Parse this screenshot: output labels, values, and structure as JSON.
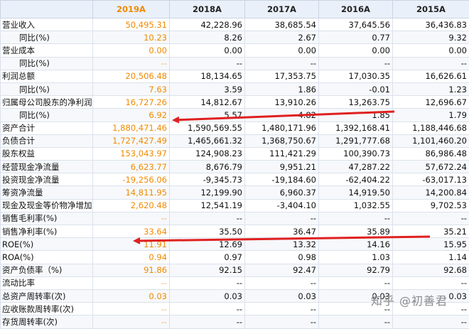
{
  "columns": [
    "",
    "2019A",
    "2018A",
    "2017A",
    "2016A",
    "2015A"
  ],
  "highlight_color": "#f08a00",
  "arrow_color": "#e02020",
  "rows": [
    {
      "label": "营业收入",
      "sub": false,
      "values": [
        "50,495.31",
        "42,228.96",
        "38,685.54",
        "37,645.56",
        "36,436.83"
      ]
    },
    {
      "label": "同比(%)",
      "sub": true,
      "values": [
        "10.23",
        "8.26",
        "2.67",
        "0.77",
        "9.32"
      ]
    },
    {
      "label": "营业成本",
      "sub": false,
      "values": [
        "0.00",
        "0.00",
        "0.00",
        "0.00",
        "0.00"
      ]
    },
    {
      "label": "同比(%)",
      "sub": true,
      "values": [
        "--",
        "--",
        "--",
        "--",
        "--"
      ]
    },
    {
      "label": "利润总额",
      "sub": false,
      "values": [
        "20,506.48",
        "18,134.65",
        "17,353.75",
        "17,030.35",
        "16,626.61"
      ]
    },
    {
      "label": "同比(%)",
      "sub": true,
      "values": [
        "7.63",
        "3.59",
        "1.86",
        "-0.01",
        "1.23"
      ]
    },
    {
      "label": "归属母公司股东的净利润",
      "sub": false,
      "values": [
        "16,727.26",
        "14,812.67",
        "13,910.26",
        "13,263.75",
        "12,696.67"
      ]
    },
    {
      "label": "同比(%)",
      "sub": true,
      "values": [
        "6.92",
        "5.57",
        "4.82",
        "1.85",
        "1.79"
      ]
    },
    {
      "label": "资产合计",
      "sub": false,
      "section": true,
      "values": [
        "1,880,471.46",
        "1,590,569.55",
        "1,480,171.96",
        "1,392,168.41",
        "1,188,446.68"
      ]
    },
    {
      "label": "负债合计",
      "sub": false,
      "values": [
        "1,727,427.49",
        "1,465,661.32",
        "1,368,750.67",
        "1,291,777.68",
        "1,101,460.20"
      ]
    },
    {
      "label": "股东权益",
      "sub": false,
      "values": [
        "153,043.97",
        "124,908.23",
        "111,421.29",
        "100,390.73",
        "86,986.48"
      ]
    },
    {
      "label": "经营现金净流量",
      "sub": false,
      "section": true,
      "values": [
        "6,623.77",
        "8,676.79",
        "9,951.21",
        "47,287.22",
        "57,672.24"
      ]
    },
    {
      "label": "投资现金净流量",
      "sub": false,
      "values": [
        "-19,256.06",
        "-9,345.73",
        "-19,184.60",
        "-62,404.22",
        "-63,017.13"
      ]
    },
    {
      "label": "筹资净流量",
      "sub": false,
      "values": [
        "14,811.95",
        "12,199.90",
        "6,960.37",
        "14,919.50",
        "14,200.84"
      ]
    },
    {
      "label": "现金及现金等价物净增加",
      "sub": false,
      "values": [
        "2,620.48",
        "12,541.19",
        "-3,404.10",
        "1,032.55",
        "9,702.53"
      ]
    },
    {
      "label": "销售毛利率(%)",
      "sub": false,
      "section": true,
      "values": [
        "--",
        "--",
        "--",
        "--",
        "--"
      ]
    },
    {
      "label": "销售净利率(%)",
      "sub": false,
      "values": [
        "33.64",
        "35.50",
        "36.47",
        "35.89",
        "35.21"
      ]
    },
    {
      "label": "ROE(%)",
      "sub": false,
      "values": [
        "11.91",
        "12.69",
        "13.32",
        "14.16",
        "15.95"
      ]
    },
    {
      "label": "ROA(%)",
      "sub": false,
      "values": [
        "0.94",
        "0.97",
        "0.98",
        "1.03",
        "1.14"
      ]
    },
    {
      "label": "资产负债率（%)",
      "sub": false,
      "values": [
        "91.86",
        "92.15",
        "92.47",
        "92.79",
        "92.68"
      ]
    },
    {
      "label": "流动比率",
      "sub": false,
      "values": [
        "--",
        "--",
        "--",
        "--",
        "--"
      ]
    },
    {
      "label": "总资产周转率(次)",
      "sub": false,
      "values": [
        "0.03",
        "0.03",
        "0.03",
        "0.03",
        "0.03"
      ]
    },
    {
      "label": "应收账款周转率(次)",
      "sub": false,
      "values": [
        "--",
        "--",
        "--",
        "--",
        "--"
      ]
    },
    {
      "label": "存货周转率(次)",
      "sub": false,
      "values": [
        "--",
        "--",
        "--",
        "--",
        "--"
      ]
    }
  ],
  "watermark": "知乎 @初善君"
}
